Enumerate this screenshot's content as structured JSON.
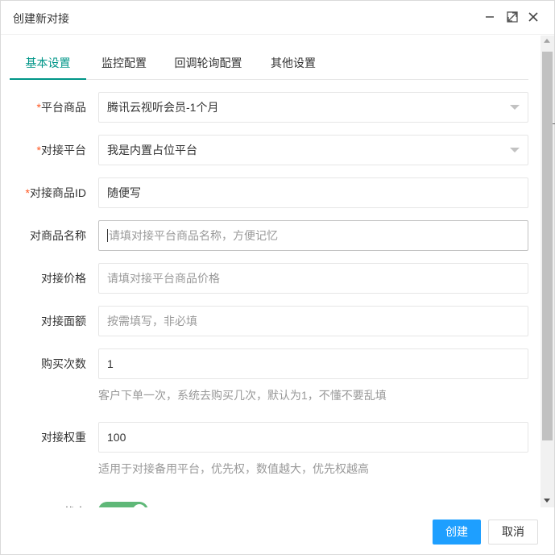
{
  "window": {
    "title": "创建新对接",
    "icons": [
      "minimize-icon",
      "maximize-icon",
      "close-icon"
    ]
  },
  "tabs": [
    {
      "label": "基本设置",
      "active": true
    },
    {
      "label": "监控配置",
      "active": false
    },
    {
      "label": "回调轮询配置",
      "active": false
    },
    {
      "label": "其他设置",
      "active": false
    }
  ],
  "form": {
    "platform_product": {
      "required_mark": "*",
      "label": "平台商品",
      "value": "腾讯云视听会员-1个月"
    },
    "docking_platform": {
      "required_mark": "*",
      "label": "对接平台",
      "value": "我是内置占位平台"
    },
    "docking_product_id": {
      "required_mark": "*",
      "label": "对接商品ID",
      "value": "随便写"
    },
    "product_name": {
      "label": "对商品名称",
      "placeholder": "请填对接平台商品名称，方便记忆"
    },
    "docking_price": {
      "label": "对接价格",
      "placeholder": "请填对接平台商品价格"
    },
    "docking_face_value": {
      "label": "对接面额",
      "placeholder": "按需填写，非必填"
    },
    "purchase_times": {
      "label": "购买次数",
      "value": "1",
      "hint": "客户下单一次，系统去购买几次，默认为1，不懂不要乱填"
    },
    "docking_weight": {
      "label": "对接权重",
      "value": "100",
      "hint": "适用于对接备用平台，优先权，数值越大，优先权越高"
    },
    "status": {
      "label": "状态",
      "enabled": true
    }
  },
  "footer": {
    "create_label": "创建",
    "cancel_label": "取消"
  },
  "colors": {
    "tab_active": "#009688",
    "primary_button": "#1e9fff",
    "required": "#ff5722",
    "switch_on": "#5fb878"
  }
}
